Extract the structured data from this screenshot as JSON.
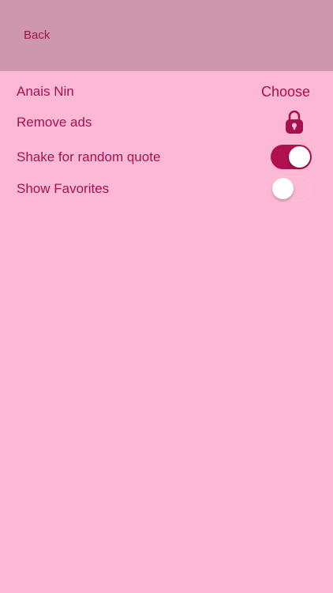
{
  "nav": {
    "back_label": "Back"
  },
  "settings": {
    "author": {
      "label": "Anais Nin",
      "action_label": "Choose"
    },
    "remove_ads": {
      "label": "Remove ads",
      "icon": "lock-icon"
    },
    "shake": {
      "label": "Shake for random quote",
      "enabled": true
    },
    "favorites": {
      "label": "Show Favorites",
      "enabled": false
    }
  },
  "colors": {
    "background": "#fdb8d6",
    "nav_bar": "#cd98ab",
    "accent": "#a3124f",
    "toggle_on": "#b0104f"
  }
}
